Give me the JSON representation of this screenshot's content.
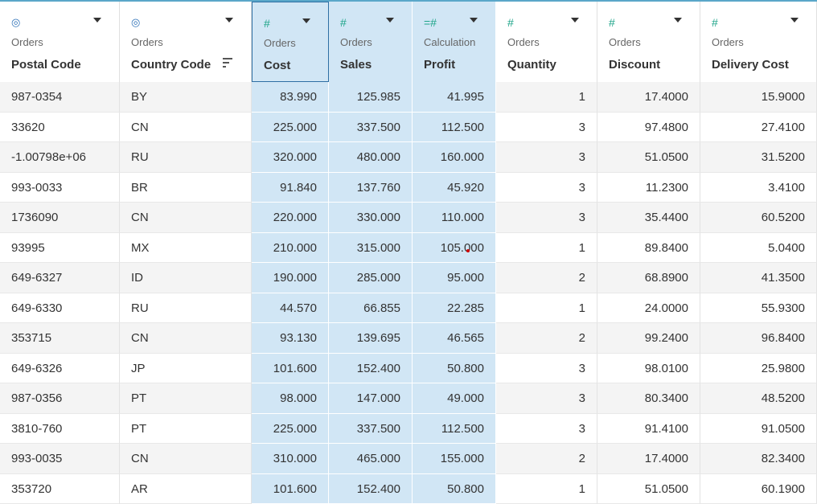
{
  "columns": [
    {
      "key": "postal_code",
      "source": "Orders",
      "name": "Postal Code",
      "type_icon": "globe-icon",
      "type_glyph": "◎",
      "align": "left",
      "selected": false,
      "sort_icon": false
    },
    {
      "key": "country_code",
      "source": "Orders",
      "name": "Country Code",
      "type_icon": "globe-icon",
      "type_glyph": "◎",
      "align": "left",
      "selected": false,
      "sort_icon": true
    },
    {
      "key": "cost",
      "source": "Orders",
      "name": "Cost",
      "type_icon": "number-icon",
      "type_glyph": "#",
      "align": "right",
      "selected": true,
      "sort_icon": false
    },
    {
      "key": "sales",
      "source": "Orders",
      "name": "Sales",
      "type_icon": "number-icon",
      "type_glyph": "#",
      "align": "right",
      "selected": true,
      "sort_icon": false
    },
    {
      "key": "profit",
      "source": "Calculation",
      "name": "Profit",
      "type_icon": "calculated-number-icon",
      "type_glyph": "=#",
      "align": "right",
      "selected": true,
      "sort_icon": false
    },
    {
      "key": "quantity",
      "source": "Orders",
      "name": "Quantity",
      "type_icon": "number-icon",
      "type_glyph": "#",
      "align": "right",
      "selected": false,
      "sort_icon": false
    },
    {
      "key": "discount",
      "source": "Orders",
      "name": "Discount",
      "type_icon": "number-icon",
      "type_glyph": "#",
      "align": "right",
      "selected": false,
      "sort_icon": false
    },
    {
      "key": "delivery_cost",
      "source": "Orders",
      "name": "Delivery Cost",
      "type_icon": "number-icon",
      "type_glyph": "#",
      "align": "right",
      "selected": false,
      "sort_icon": false
    }
  ],
  "rows": [
    [
      "987-0354",
      "BY",
      "83.990",
      "125.985",
      "41.995",
      "1",
      "17.4000",
      "15.9000"
    ],
    [
      "33620",
      "CN",
      "225.000",
      "337.500",
      "112.500",
      "3",
      "97.4800",
      "27.4100"
    ],
    [
      "-1.00798e+06",
      "RU",
      "320.000",
      "480.000",
      "160.000",
      "3",
      "51.0500",
      "31.5200"
    ],
    [
      "993-0033",
      "BR",
      "91.840",
      "137.760",
      "45.920",
      "3",
      "11.2300",
      "3.4100"
    ],
    [
      "1736090",
      "CN",
      "220.000",
      "330.000",
      "110.000",
      "3",
      "35.4400",
      "60.5200"
    ],
    [
      "93995",
      "MX",
      "210.000",
      "315.000",
      "105.000",
      "1",
      "89.8400",
      "5.0400"
    ],
    [
      "649-6327",
      "ID",
      "190.000",
      "285.000",
      "95.000",
      "2",
      "68.8900",
      "41.3500"
    ],
    [
      "649-6330",
      "RU",
      "44.570",
      "66.855",
      "22.285",
      "1",
      "24.0000",
      "55.9300"
    ],
    [
      "353715",
      "CN",
      "93.130",
      "139.695",
      "46.565",
      "2",
      "99.2400",
      "96.8400"
    ],
    [
      "649-6326",
      "JP",
      "101.600",
      "152.400",
      "50.800",
      "3",
      "98.0100",
      "25.9800"
    ],
    [
      "987-0356",
      "PT",
      "98.000",
      "147.000",
      "49.000",
      "3",
      "80.3400",
      "48.5200"
    ],
    [
      "3810-760",
      "PT",
      "225.000",
      "337.500",
      "112.500",
      "3",
      "91.4100",
      "91.0500"
    ],
    [
      "993-0035",
      "CN",
      "310.000",
      "465.000",
      "155.000",
      "2",
      "17.4000",
      "82.3400"
    ],
    [
      "353720",
      "AR",
      "101.600",
      "152.400",
      "50.800",
      "1",
      "51.0500",
      "60.1900"
    ]
  ],
  "colors": {
    "selection": "#d1e6f5",
    "number_icon": "#20a58a",
    "globe_icon": "#2f72b8",
    "header_top_border": "#5aa7c9"
  }
}
